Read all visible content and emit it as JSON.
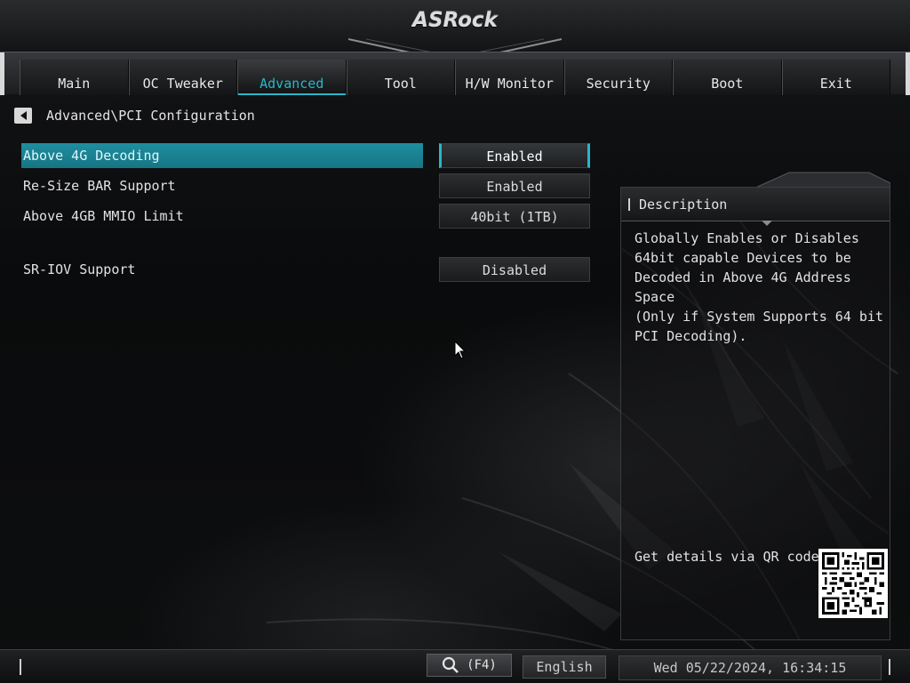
{
  "brand": {
    "logo_text": "ASRock"
  },
  "tabs": [
    {
      "label": "Main",
      "active": false
    },
    {
      "label": "OC Tweaker",
      "active": false
    },
    {
      "label": "Advanced",
      "active": true
    },
    {
      "label": "Tool",
      "active": false
    },
    {
      "label": "H/W Monitor",
      "active": false
    },
    {
      "label": "Security",
      "active": false
    },
    {
      "label": "Boot",
      "active": false
    },
    {
      "label": "Exit",
      "active": false
    }
  ],
  "breadcrumb": {
    "path": "Advanced\\PCI Configuration",
    "back_icon": "back-arrow-icon"
  },
  "settings": [
    {
      "label": "Above 4G Decoding",
      "value": "Enabled",
      "selected": true
    },
    {
      "label": "Re-Size BAR Support",
      "value": "Enabled",
      "selected": false
    },
    {
      "label": "Above 4GB MMIO Limit",
      "value": "40bit (1TB)",
      "selected": false
    },
    {
      "label": "SR-IOV Support",
      "value": "Disabled",
      "selected": false
    }
  ],
  "description": {
    "title": "Description",
    "text": "Globally Enables or Disables\n64bit capable Devices to be\nDecoded in Above 4G Address Space\n(Only if System Supports 64 bit\nPCI Decoding).",
    "qr_label": "Get details via QR code"
  },
  "bottom_bar": {
    "search_label": "(F4)",
    "search_icon": "magnifier-icon",
    "language": "English",
    "datetime": "Wed 05/22/2024, 16:34:15"
  },
  "colors": {
    "accent": "#29b6c9",
    "selected_row": "#1e8ea0",
    "background": "#0b0c0d"
  }
}
